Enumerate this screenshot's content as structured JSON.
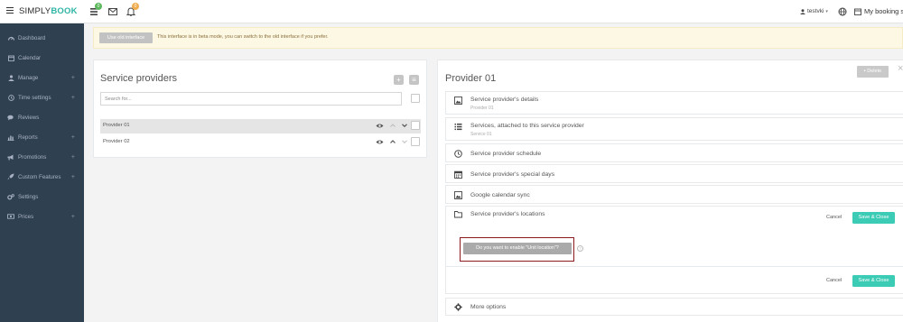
{
  "topbar": {
    "logo_simply": "SIMPLY",
    "logo_book": "BOOK",
    "badge_1": "0",
    "badge_2": "0",
    "user_name": "testvki",
    "my_booking": "My booking s"
  },
  "sidebar": {
    "items": [
      {
        "label": "Dashboard",
        "icon": "dashboard-icon",
        "plus": false
      },
      {
        "label": "Calendar",
        "icon": "calendar-icon",
        "plus": false
      },
      {
        "label": "Manage",
        "icon": "user-icon",
        "plus": true
      },
      {
        "label": "Time settings",
        "icon": "clock-icon",
        "plus": true
      },
      {
        "label": "Reviews",
        "icon": "comments-icon",
        "plus": false
      },
      {
        "label": "Reports",
        "icon": "bar-chart-icon",
        "plus": true
      },
      {
        "label": "Promotions",
        "icon": "megaphone-icon",
        "plus": true
      },
      {
        "label": "Custom Features",
        "icon": "rocket-icon",
        "plus": true
      },
      {
        "label": "Settings",
        "icon": "cogs-icon",
        "plus": false
      },
      {
        "label": "Prices",
        "icon": "money-icon",
        "plus": true
      }
    ],
    "plus_sign": "+"
  },
  "banner": {
    "button_label": "Use old interface",
    "message": "This interface is in beta mode, you can switch to the old interface if you prefer."
  },
  "providers_panel": {
    "title": "Service providers",
    "add_label": "+",
    "list_label": "≡",
    "search_placeholder": "Search for...",
    "rows": [
      {
        "name": "Provider 01",
        "selected": true
      },
      {
        "name": "Provider 02",
        "selected": false
      }
    ]
  },
  "detail_panel": {
    "title": "Provider 01",
    "delete_label": "Delete",
    "close_label": "×",
    "sections": {
      "details": {
        "title": "Service provider's details",
        "subtitle": "Provider 01"
      },
      "services": {
        "title": "Services, attached to this service provider",
        "subtitle": "Service 01"
      },
      "schedule": {
        "title": "Service provider schedule"
      },
      "special_days": {
        "title": "Service provider's special days"
      },
      "gcal": {
        "title": "Google calendar sync"
      },
      "locations": {
        "title": "Service provider's locations"
      },
      "more": {
        "title": "More options"
      }
    },
    "cancel_label": "Cancel",
    "save_label": "Save & Close",
    "unit_location_question": "Do you want to enable \"Unit location\"?",
    "info_glyph": "?"
  },
  "colors": {
    "sidebar_bg": "#2f4050",
    "accent_teal": "#3ccbb4",
    "banner_bg": "#fcf8e3",
    "highlight_border": "#8b1a1a"
  }
}
